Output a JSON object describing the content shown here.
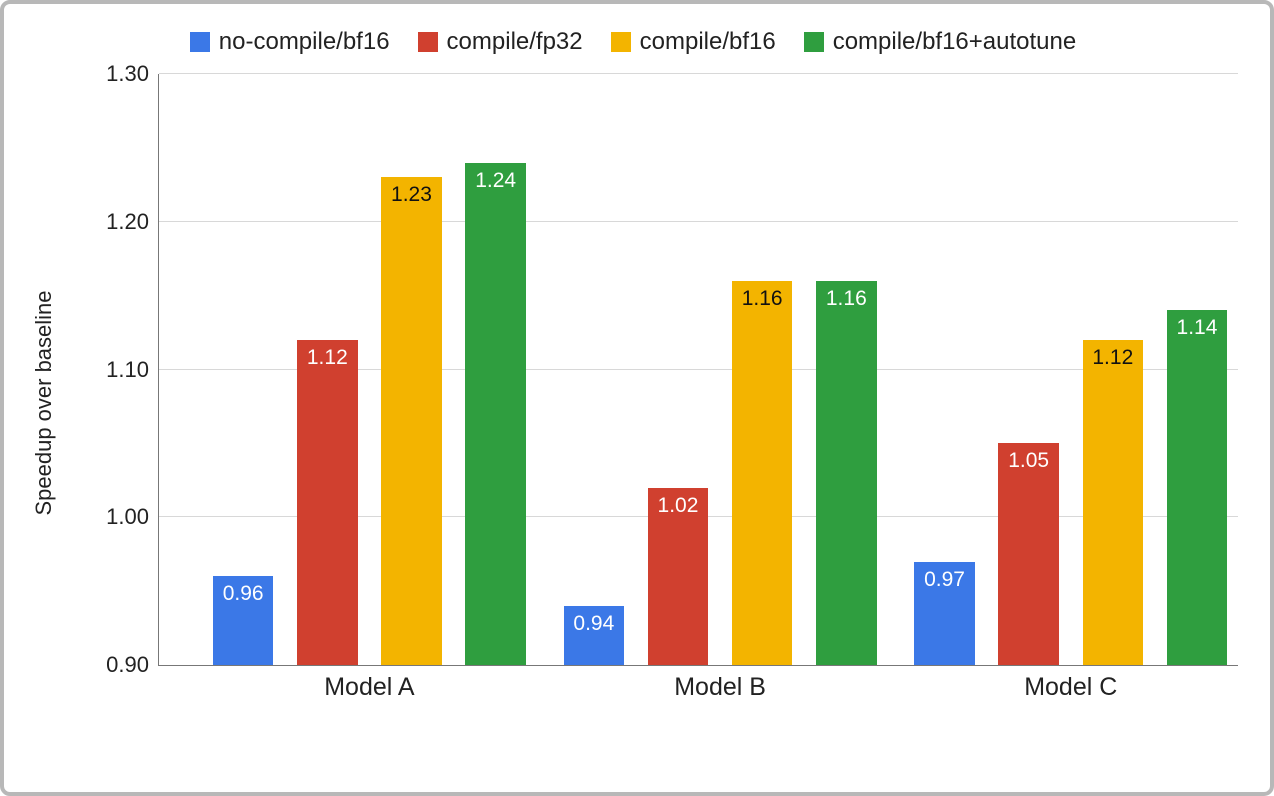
{
  "chart_data": {
    "type": "bar",
    "title": "",
    "xlabel": "",
    "ylabel": "Speedup over baseline",
    "ylim": [
      0.9,
      1.3
    ],
    "yticks": [
      0.9,
      1.0,
      1.1,
      1.2,
      1.3
    ],
    "ytick_labels": [
      "0.90",
      "1.00",
      "1.10",
      "1.20",
      "1.30"
    ],
    "categories": [
      "Model A",
      "Model B",
      "Model C"
    ],
    "series": [
      {
        "name": "no-compile/bf16",
        "color": "#3b78e7",
        "values": [
          0.96,
          0.94,
          0.97
        ]
      },
      {
        "name": "compile/fp32",
        "color": "#d0402f",
        "values": [
          1.12,
          1.02,
          1.05
        ]
      },
      {
        "name": "compile/bf16",
        "color": "#f3b400",
        "values": [
          1.23,
          1.16,
          1.12
        ]
      },
      {
        "name": "compile/bf16+autotune",
        "color": "#2f9e3f",
        "values": [
          1.24,
          1.16,
          1.14
        ]
      }
    ],
    "value_labels": [
      [
        "0.96",
        "0.94",
        "0.97"
      ],
      [
        "1.12",
        "1.02",
        "1.05"
      ],
      [
        "1.23",
        "1.16",
        "1.12"
      ],
      [
        "1.24",
        "1.16",
        "1.14"
      ]
    ],
    "label_text_dark": [
      [
        false,
        false,
        false
      ],
      [
        false,
        false,
        false
      ],
      [
        true,
        true,
        true
      ],
      [
        false,
        false,
        false
      ]
    ]
  },
  "layout": {
    "bar_width_pct": 5.6,
    "group_gap_pct": 2.2,
    "group_centers_pct": [
      19.5,
      52.0,
      84.5
    ]
  }
}
